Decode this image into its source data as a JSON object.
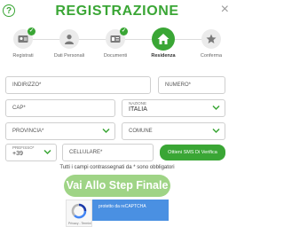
{
  "header": {
    "title": "REGISTRAZIONE",
    "help_icon": "help-icon",
    "close_icon": "close-icon",
    "help_glyph": "?",
    "close_glyph": "×"
  },
  "steps": [
    {
      "label": "Registrati",
      "icon": "id-card-icon",
      "done": true
    },
    {
      "label": "Dati Personali",
      "icon": "user-icon",
      "done": false
    },
    {
      "label": "Documenti",
      "icon": "document-icon",
      "done": true
    },
    {
      "label": "Residenza",
      "icon": "home-icon",
      "active": true
    },
    {
      "label": "Conferma",
      "icon": "star-icon",
      "done": false
    }
  ],
  "form": {
    "indirizzo_placeholder": "INDIRIZZO*",
    "numero_placeholder": "NUMERO*",
    "cap_placeholder": "CAP*",
    "nazione_label": "NAZIONE",
    "nazione_value": "ITALIA",
    "provincia_placeholder": "PROVINCIA*",
    "comune_placeholder": "COMUNE",
    "prefisso_label": "PREFISSO*",
    "prefisso_value": "+39",
    "cellulare_placeholder": "CELLULARE*",
    "sms_button": "Ottieni SMS Di Verifica"
  },
  "required_note": "Tutti i campi contrassegnati da * sono obbligatori",
  "next_button": "Vai Allo Step Finale",
  "captcha": {
    "text": "protetto da reCAPTCHA",
    "privacy": "Privacy - Termini"
  },
  "colors": {
    "accent": "#3aa635",
    "next_button": "#9fd486",
    "captcha": "#4a90e2"
  }
}
